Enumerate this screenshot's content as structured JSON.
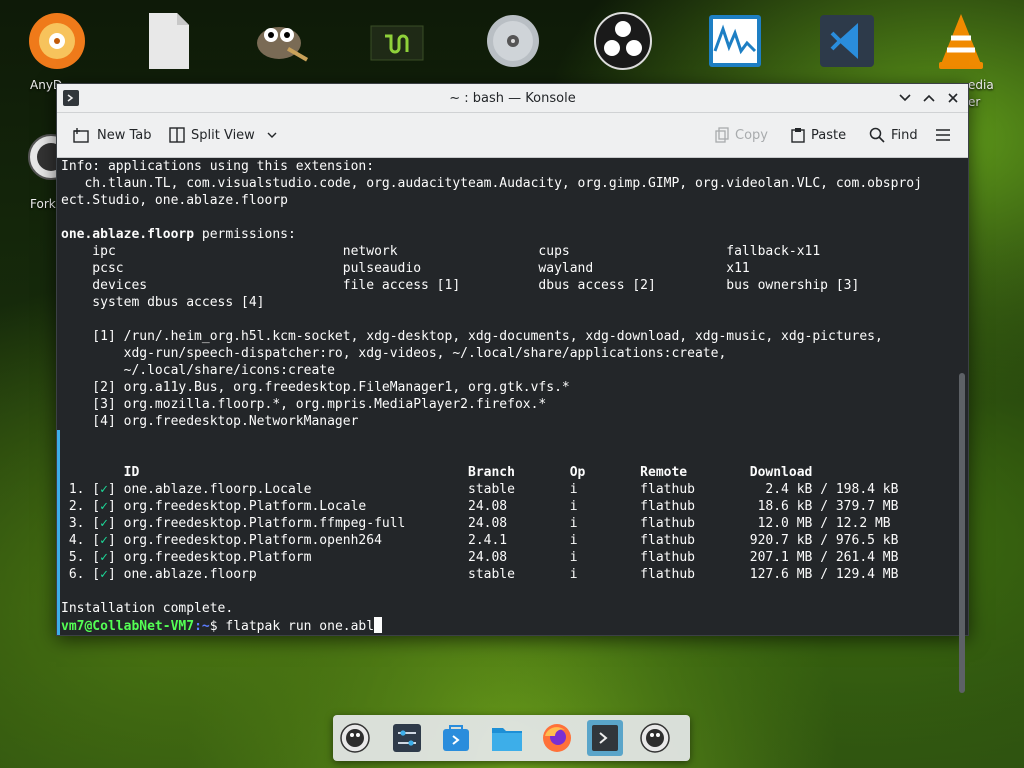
{
  "desktop": {
    "icons": [
      {
        "name": "anydesk-icon",
        "label": "AnyD"
      },
      {
        "name": "file-icon",
        "label": ""
      },
      {
        "name": "gimp-icon",
        "label": ""
      },
      {
        "name": "linux-mint-icon",
        "label": ""
      },
      {
        "name": "disc-icon",
        "label": ""
      },
      {
        "name": "obs-icon",
        "label": ""
      },
      {
        "name": "waveform-icon",
        "label": ""
      },
      {
        "name": "vscode-icon",
        "label": ""
      },
      {
        "name": "vlc-icon",
        "label": "edia"
      },
      {
        "name": "fork-icon",
        "label": "Fork"
      }
    ],
    "vlc_label_line2": "er"
  },
  "window": {
    "title": "~ : bash — Konsole",
    "toolbar": {
      "new_tab": "New Tab",
      "split_view": "Split View",
      "copy": "Copy",
      "paste": "Paste",
      "find": "Find"
    }
  },
  "terminal": {
    "lines": [
      "Info: applications using this extension:",
      "   ch.tlaun.TL, com.visualstudio.code, org.audacityteam.Audacity, org.gimp.GIMP, org.videolan.VLC, com.obsproj",
      "ect.Studio, one.ablaze.floorp",
      "",
      "__BOLD__one.ablaze.floorp__END__ permissions:",
      "    ipc                             network                  cups                    fallback-x11",
      "    pcsc                            pulseaudio               wayland                 x11",
      "    devices                         file access [1]          dbus access [2]         bus ownership [3]",
      "    system dbus access [4]",
      "",
      "    [1] /run/.heim_org.h5l.kcm-socket, xdg-desktop, xdg-documents, xdg-download, xdg-music, xdg-pictures,",
      "        xdg-run/speech-dispatcher:ro, xdg-videos, ~/.local/share/applications:create,",
      "        ~/.local/share/icons:create",
      "    [2] org.a11y.Bus, org.freedesktop.FileManager1, org.gtk.vfs.*",
      "    [3] org.mozilla.floorp.*, org.mpris.MediaPlayer2.firefox.*",
      "    [4] org.freedesktop.NetworkManager",
      "",
      ""
    ],
    "table": {
      "headers": [
        "ID",
        "Branch",
        "Op",
        "Remote",
        "Download"
      ],
      "rows": [
        {
          "num": "1.",
          "id": "one.ablaze.floorp.Locale",
          "branch": "stable",
          "op": "i",
          "remote": "flathub",
          "download": "  2.4 kB / 198.4 kB"
        },
        {
          "num": "2.",
          "id": "org.freedesktop.Platform.Locale",
          "branch": "24.08",
          "op": "i",
          "remote": "flathub",
          "download": " 18.6 kB / 379.7 MB"
        },
        {
          "num": "3.",
          "id": "org.freedesktop.Platform.ffmpeg-full",
          "branch": "24.08",
          "op": "i",
          "remote": "flathub",
          "download": " 12.0 MB / 12.2 MB"
        },
        {
          "num": "4.",
          "id": "org.freedesktop.Platform.openh264",
          "branch": "2.4.1",
          "op": "i",
          "remote": "flathub",
          "download": "920.7 kB / 976.5 kB"
        },
        {
          "num": "5.",
          "id": "org.freedesktop.Platform",
          "branch": "24.08",
          "op": "i",
          "remote": "flathub",
          "download": "207.1 MB / 261.4 MB"
        },
        {
          "num": "6.",
          "id": "one.ablaze.floorp",
          "branch": "stable",
          "op": "i",
          "remote": "flathub",
          "download": "127.6 MB / 129.4 MB"
        }
      ],
      "check": "✓"
    },
    "complete": "Installation complete.",
    "prompt_user": "vm7@CollabNet-VM7",
    "prompt_path": ":~",
    "prompt_symbol": "$",
    "command": " flatpak run one.abl"
  },
  "taskbar": {
    "items": [
      {
        "name": "taskbar-app-1"
      },
      {
        "name": "taskbar-system-settings"
      },
      {
        "name": "taskbar-discover"
      },
      {
        "name": "taskbar-file-manager"
      },
      {
        "name": "taskbar-firefox"
      },
      {
        "name": "taskbar-konsole"
      },
      {
        "name": "taskbar-app-7"
      }
    ]
  }
}
